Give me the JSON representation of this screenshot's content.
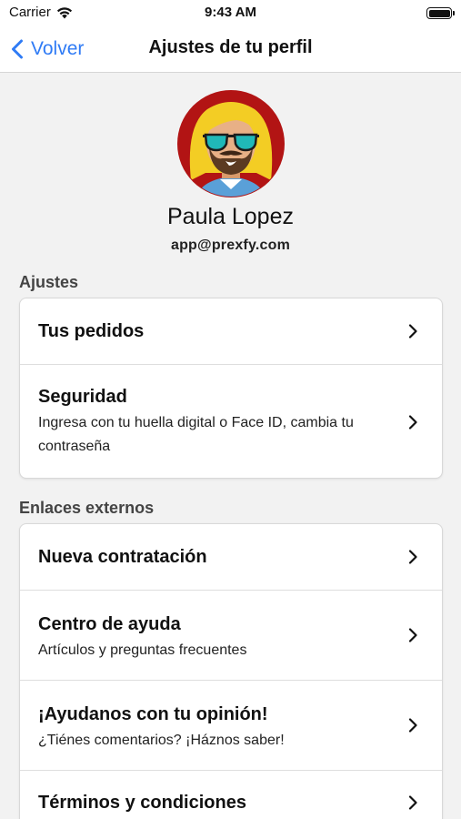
{
  "status_bar": {
    "carrier": "Carrier",
    "time": "9:43 AM",
    "wifi_icon": "wifi-icon",
    "battery_icon": "battery-icon"
  },
  "nav": {
    "back_label": "Volver",
    "title": "Ajustes de tu perfil",
    "accent_color": "#2f7bf5"
  },
  "profile": {
    "name": "Paula Lopez",
    "email": "app@prexfy.com",
    "avatar_icon": "avatar-icon"
  },
  "settings": {
    "header": "Ajustes",
    "items": [
      {
        "title": "Tus pedidos",
        "subtitle": ""
      },
      {
        "title": "Seguridad",
        "subtitle": "Ingresa con tu huella digital o Face ID, cambia tu contraseña"
      }
    ]
  },
  "external": {
    "header": "Enlaces externos",
    "items": [
      {
        "title": "Nueva contratación",
        "subtitle": ""
      },
      {
        "title": "Centro de ayuda",
        "subtitle": "Artículos y preguntas frecuentes"
      },
      {
        "title": "¡Ayudanos con tu opinión!",
        "subtitle": "¿Tiénes comentarios? ¡Háznos saber!"
      },
      {
        "title": "Términos y condiciones",
        "subtitle": ""
      }
    ]
  }
}
